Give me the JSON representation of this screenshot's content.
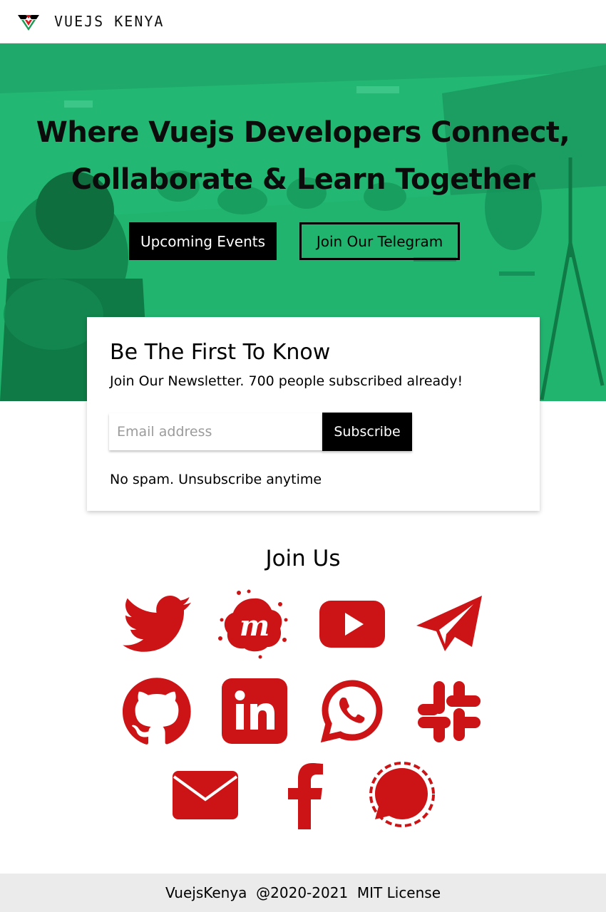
{
  "brand": {
    "name": "VUEJS KENYA",
    "logo_icon": "vuejs-kenya-logo-icon"
  },
  "hero": {
    "title_line1": "Where Vuejs Developers Connect,",
    "title_line2": "Collaborate & Learn Together",
    "events_button": "Upcoming Events",
    "telegram_button": "Join Our Telegram",
    "overlay_color": "#22b873"
  },
  "newsletter": {
    "heading": "Be The First To Know",
    "subheading": "Join Our Newsletter. 700 people subscribed already!",
    "email_placeholder": "Email address",
    "email_value": "",
    "subscribe_button": "Subscribe",
    "note": "No spam. Unsubscribe anytime"
  },
  "join": {
    "title": "Join Us",
    "icon_color": "#cc1416",
    "icons": [
      "twitter-icon",
      "meetup-icon",
      "youtube-icon",
      "telegram-icon",
      "github-icon",
      "linkedin-icon",
      "whatsapp-icon",
      "slack-icon",
      "email-icon",
      "facebook-icon",
      "signal-icon"
    ]
  },
  "footer": {
    "text": "VuejsKenya  @2020-2021  MIT License"
  }
}
